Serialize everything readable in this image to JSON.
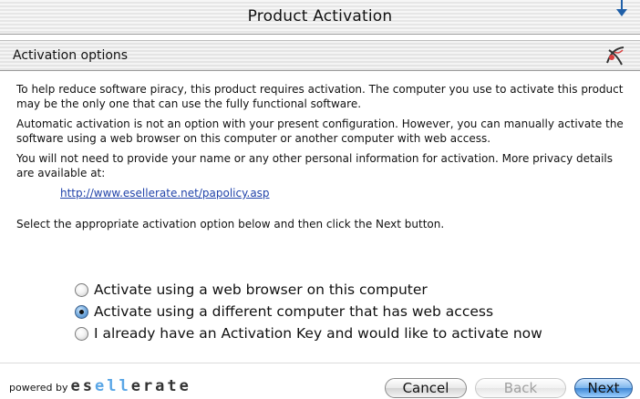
{
  "window": {
    "title": "Product Activation"
  },
  "header": {
    "label": "Activation options"
  },
  "body": {
    "paragraphs": [
      "To help reduce software piracy, this product requires activation. The computer you use to activate this product may be the only one that can use the fully functional software.",
      "Automatic activation is not an option with your present configuration. However, you can manually activate the software using a web browser on this computer or another computer with web access.",
      "You will not need to provide your name or any other personal information for activation. More privacy details are available at:"
    ],
    "link": "http://www.esellerate.net/papolicy.asp",
    "instruction": "Select the appropriate activation option below and then click the Next button."
  },
  "options": [
    {
      "label": "Activate using a web browser on this computer",
      "selected": false
    },
    {
      "label": "Activate using a different computer that has web access",
      "selected": true
    },
    {
      "label": "I already have an Activation Key and would like to activate now",
      "selected": false
    }
  ],
  "footer": {
    "powered_by": "powered by",
    "brand": "esellerate",
    "cancel": "Cancel",
    "back": "Back",
    "next": "Next"
  },
  "colors": {
    "link": "#2244aa",
    "accent": "#3d86d4",
    "brand_highlight": "#5aa6e6"
  }
}
